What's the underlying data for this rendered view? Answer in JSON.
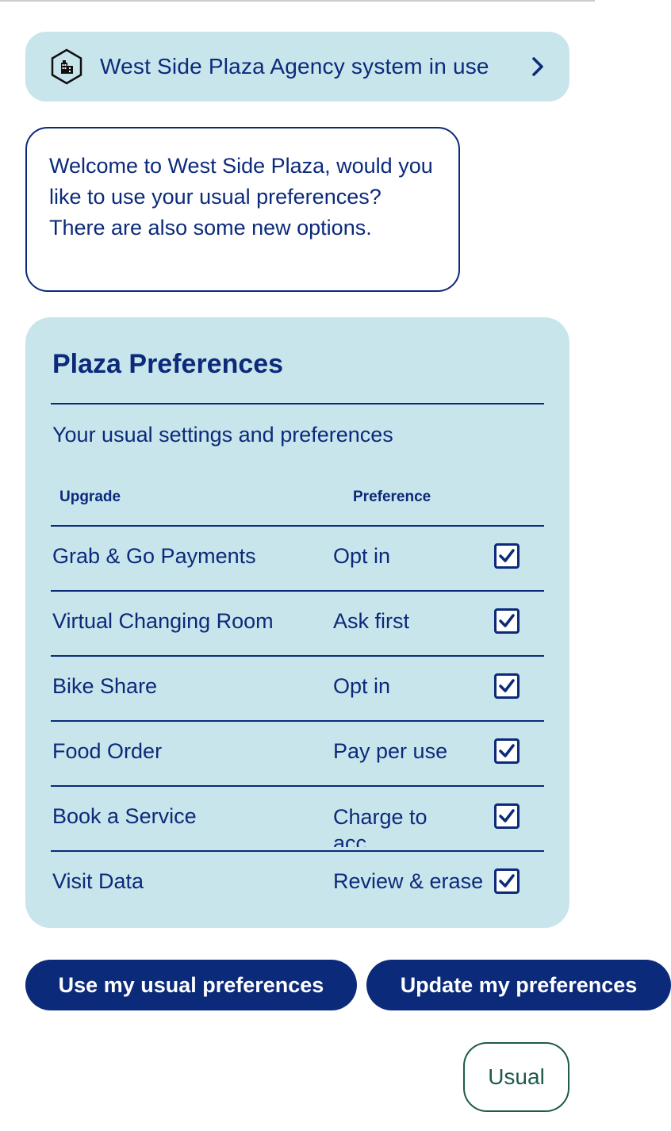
{
  "banner": {
    "label": "West Side Plaza Agency system in use",
    "icon": "building-icon",
    "chevron_icon": "chevron-right-icon"
  },
  "message": {
    "text": "Welcome to West Side Plaza, would you like to use your usual preferences? There are also some new options."
  },
  "preferences": {
    "title": "Plaza Preferences",
    "subtitle": "Your usual settings and preferences",
    "columns": {
      "upgrade": "Upgrade",
      "preference": "Preference"
    },
    "rows": [
      {
        "upgrade": "Grab & Go Payments",
        "preference": "Opt in",
        "checked": true
      },
      {
        "upgrade": "Virtual Changing Room",
        "preference": "Ask first",
        "checked": true
      },
      {
        "upgrade": "Bike Share",
        "preference": "Opt in",
        "checked": true
      },
      {
        "upgrade": "Food Order",
        "preference": "Pay per use",
        "checked": true
      },
      {
        "upgrade": "Book a Service",
        "preference": "Charge to acc...",
        "checked": true
      },
      {
        "upgrade": "Visit Data",
        "preference": "Review & erase",
        "checked": true
      }
    ]
  },
  "actions": {
    "use_usual_label": "Use my usual preferences",
    "update_label": "Update my preferences",
    "usual_reply_label": "Usual"
  },
  "colors": {
    "navy": "#0b2a7a",
    "card_bg": "#c9e5ec",
    "usual_border": "#1f5a4c"
  }
}
